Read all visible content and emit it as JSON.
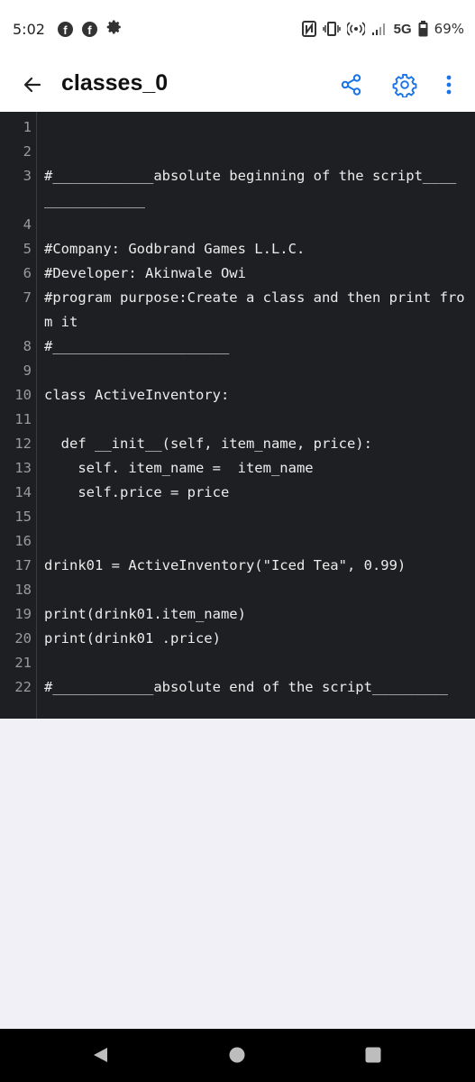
{
  "status_bar": {
    "time": "5:02",
    "network": "5G",
    "battery": "69%",
    "icons": [
      "facebook-icon",
      "facebook-icon",
      "settings-gear-icon",
      "nfc-icon",
      "vibrate-icon",
      "hotspot-icon",
      "signal-icon",
      "battery-icon"
    ]
  },
  "app_bar": {
    "title": "classes_0",
    "back_icon": "arrow-left-icon",
    "share_icon": "share-icon",
    "settings_icon": "gear-icon",
    "more_icon": "more-vertical-icon",
    "accent_color": "#1a73e8"
  },
  "code": {
    "lines": [
      {
        "num": "1",
        "text": ""
      },
      {
        "num": "2",
        "text": ""
      },
      {
        "num": "3",
        "text": "#____________absolute beginning of the script____"
      },
      {
        "num": "",
        "text": "____________"
      },
      {
        "num": "4",
        "text": ""
      },
      {
        "num": "5",
        "text": "#Company: Godbrand Games L.L.C."
      },
      {
        "num": "6",
        "text": "#Developer: Akinwale Owi"
      },
      {
        "num": "7",
        "text": "#program purpose:Create a class and then print fro"
      },
      {
        "num": "",
        "text": "m it"
      },
      {
        "num": "8",
        "text": "#_____________________"
      },
      {
        "num": "9",
        "text": ""
      },
      {
        "num": "10",
        "text": "class ActiveInventory:"
      },
      {
        "num": "11",
        "text": ""
      },
      {
        "num": "12",
        "text": "  def __init__(self, item_name, price):"
      },
      {
        "num": "13",
        "text": "    self. item_name =  item_name"
      },
      {
        "num": "14",
        "text": "    self.price = price"
      },
      {
        "num": "15",
        "text": ""
      },
      {
        "num": "16",
        "text": ""
      },
      {
        "num": "17",
        "text": "drink01 = ActiveInventory(\"Iced Tea\", 0.99)"
      },
      {
        "num": "18",
        "text": ""
      },
      {
        "num": "19",
        "text": "print(drink01.item_name)"
      },
      {
        "num": "20",
        "text": "print(drink01 .price)"
      },
      {
        "num": "21",
        "text": ""
      },
      {
        "num": "22",
        "text": "#____________absolute end of the script_________"
      },
      {
        "num": "",
        "text": "______"
      }
    ]
  },
  "nav_bar": {
    "back_icon": "triangle-back-icon",
    "home_icon": "circle-home-icon",
    "recents_icon": "square-recents-icon"
  }
}
